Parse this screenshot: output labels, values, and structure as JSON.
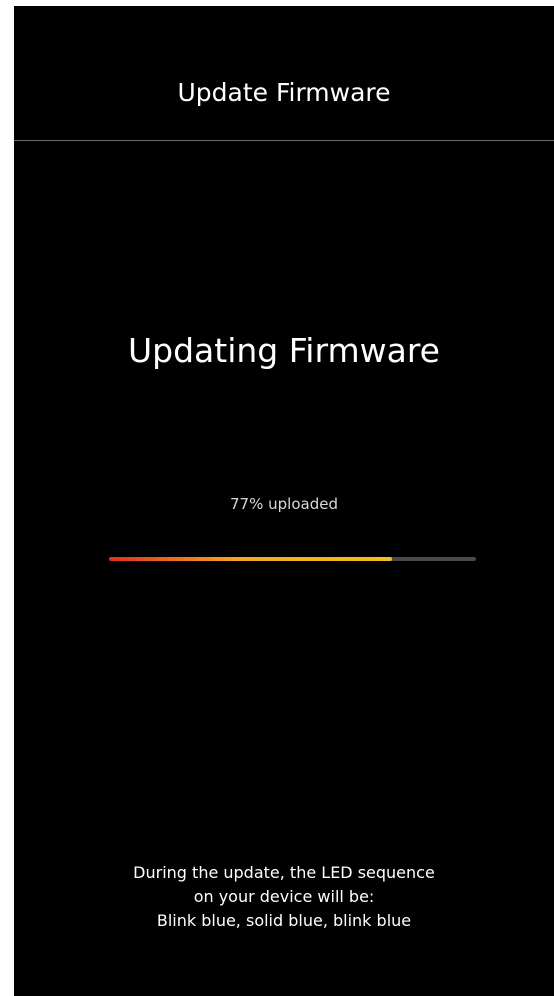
{
  "header": {
    "title": "Update Firmware"
  },
  "main": {
    "title": "Updating Firmware",
    "progress_label": "77% uploaded",
    "progress_fraction": 0.77,
    "progress_colors": {
      "start": "#e0301e",
      "mid": "#f5a623",
      "end": "#f2c21b",
      "track": "#4a4a4a"
    }
  },
  "info": {
    "line1": "During the update, the LED sequence",
    "line2": "on your device will be:",
    "line3": "Blink blue, solid blue, blink blue"
  }
}
